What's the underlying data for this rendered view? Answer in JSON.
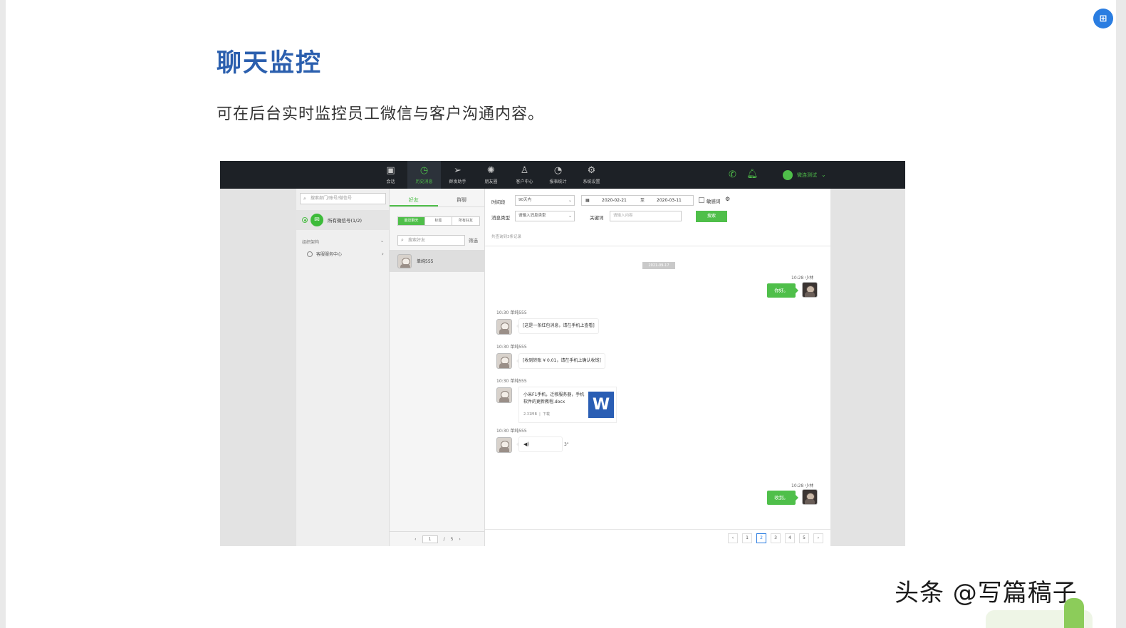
{
  "slide": {
    "title": "聊天监控",
    "description": "可在后台实时监控员工微信与客户沟通内容。"
  },
  "corner_button": {
    "icon": "translate-icon",
    "label": ""
  },
  "topbar": {
    "nav": [
      {
        "label": "会话",
        "icon": "chat-icon",
        "active": false
      },
      {
        "label": "历史消息",
        "icon": "clock-icon",
        "active": true
      },
      {
        "label": "群发助手",
        "icon": "send-icon",
        "active": false
      },
      {
        "label": "朋友圈",
        "icon": "aperture-icon",
        "active": false
      },
      {
        "label": "客户中心",
        "icon": "person-icon",
        "active": false
      },
      {
        "label": "报表统计",
        "icon": "pie-chart-icon",
        "active": false
      },
      {
        "label": "系统设置",
        "icon": "gear-icon",
        "active": false
      }
    ],
    "username": "微连测试",
    "accent_color": "#4fbf4a"
  },
  "left_panel": {
    "search_placeholder": "搜索部门/账号/微信号",
    "account_label": "所有微信号(1/2)",
    "org_label": "组织架构",
    "org_child": "客服服务中心"
  },
  "mid_panel": {
    "tabs": [
      "好友",
      "群聊"
    ],
    "segments": [
      "最近聊天",
      "标签",
      "所有好友"
    ],
    "search_placeholder": "搜索好友",
    "filter_label": "筛选",
    "friend_name": "单纯555",
    "pager": {
      "current": "1",
      "separator": "/",
      "total": "5"
    }
  },
  "chat_panel": {
    "filters": {
      "period_label": "时间段",
      "period_value": "90天内",
      "date_start": "2020-02-21",
      "date_sep": "至",
      "date_end": "2020-03-11",
      "sensitive_label": "敏感词",
      "msg_type_label": "消息类型",
      "msg_type_placeholder": "请输入消息类型",
      "keyword_label": "关键词",
      "keyword_placeholder": "请输入内容",
      "search_button": "搜索"
    },
    "result_count": "共查询到3条记录",
    "date_divider": "2021-09-17",
    "messages": [
      {
        "direction": "out",
        "meta": "10:28  小林",
        "text": "你好。"
      },
      {
        "direction": "in",
        "meta": "10:30  单纯555",
        "text": "[这是一条红包消息，请在手机上查看]"
      },
      {
        "direction": "in",
        "meta": "10:30  单纯555",
        "text": "[收到转账 ¥ 0.01，请在手机上确认收钱]"
      },
      {
        "direction": "in",
        "meta": "10:30  单纯555",
        "file_name": "小米F1手机，迁移服务器，手机软件的更新教程.docx",
        "file_size": "2.31MB",
        "file_sep": "|",
        "file_action": "下载",
        "file_icon_letter": "W"
      },
      {
        "direction": "in",
        "meta": "10:30  单纯555",
        "voice_icon": "◀)",
        "voice_length": "3\""
      },
      {
        "direction": "out",
        "meta": "10:28  小林",
        "text": "收到。"
      }
    ],
    "pager": {
      "prev": "‹",
      "next": "›",
      "pages": [
        "1",
        "2",
        "3",
        "4",
        "5"
      ],
      "active_page": "2"
    }
  },
  "watermark": "头条 @写篇稿子"
}
